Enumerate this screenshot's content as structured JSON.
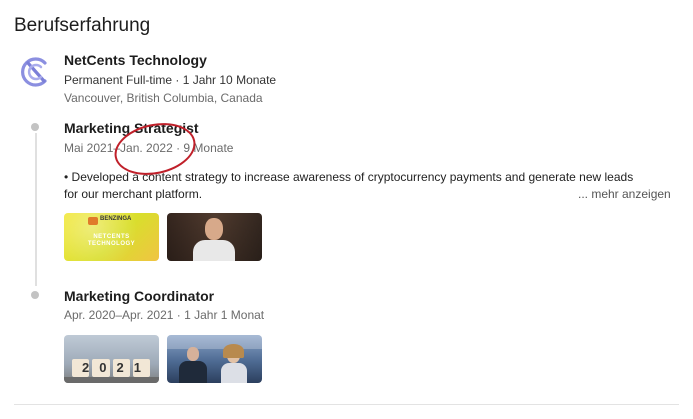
{
  "section": {
    "title": "Berufserfahrung"
  },
  "company": {
    "name": "NetCents Technology",
    "employment": "Permanent Full-time · 1 Jahr 10 Monate",
    "location": "Vancouver, British Columbia, Canada",
    "logo_icon": "netcents-logo-icon"
  },
  "positions": [
    {
      "title": "Marketing Strategist",
      "dates": "Mai 2021–Jan. 2022 · 9 Monate",
      "description_line1": "• Developed a content strategy to increase awareness of cryptocurrency payments and generate new leads",
      "description_line2": "for our merchant platform.",
      "more_label": "... mehr anzeigen",
      "media": [
        {
          "type": "image",
          "line1": "BENZINGA",
          "line2": "NETCENTS",
          "line3": "TECHNOLOGY",
          "icon": "benzinga-banner-thumbnail"
        },
        {
          "type": "video",
          "icon": "speaker-video-thumbnail"
        }
      ]
    },
    {
      "title": "Marketing Coordinator",
      "dates": "Apr. 2020–Apr. 2021 · 1 Jahr 1 Monat",
      "media": [
        {
          "type": "image",
          "text": "2021",
          "icon": "2021-blocks-thumbnail"
        },
        {
          "type": "video",
          "icon": "news-anchors-thumbnail"
        }
      ]
    }
  ],
  "colors": {
    "annotation": "#c0202a",
    "logo": "#7b7fd8",
    "banner": "#e8e52a"
  }
}
